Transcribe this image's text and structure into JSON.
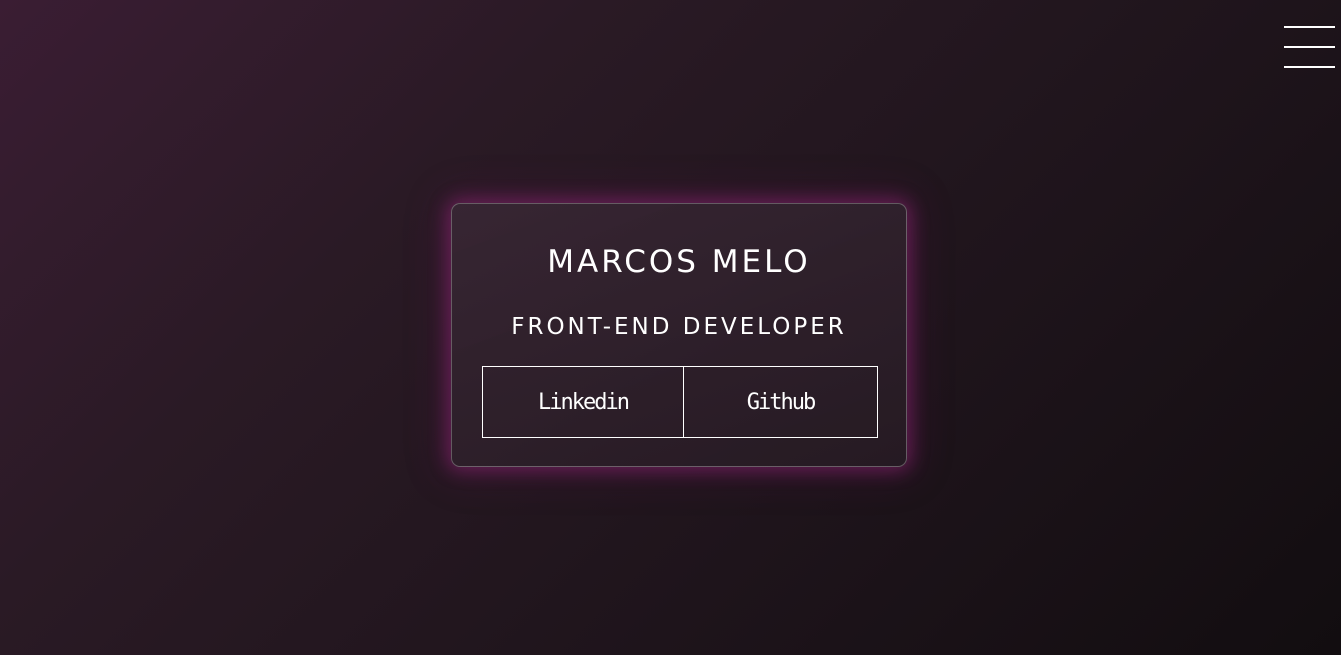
{
  "header": {
    "menu_icon": "hamburger-menu-icon"
  },
  "card": {
    "name": "MARCOS MELO",
    "role": "FRONT-END DEVELOPER",
    "links": [
      {
        "label": "Linkedin"
      },
      {
        "label": "Github"
      }
    ]
  },
  "colors": {
    "background_start": "#3a1d33",
    "background_end": "#120d10",
    "glow": "#aa288c",
    "text": "#ffffff"
  }
}
